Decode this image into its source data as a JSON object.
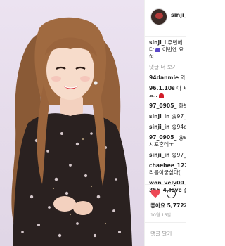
{
  "post": {
    "username": "sinji_i",
    "likes": "좋아요 5,772개",
    "date": "10월 16일",
    "add_comment": "댓글 달기..."
  },
  "caption": {
    "username": "sinji_i",
    "line1": " 주변에",
    "line2a": "다 ",
    "line2b": " 이번엔 요",
    "line3": "혀"
  },
  "more_comments": "댓글 더 보기",
  "comments": [
    {
      "user": "94danmie",
      "text": " 와..."
    },
    {
      "user": "96.1.10s",
      "text": " 아 세상"
    },
    {
      "user": "",
      "text": "요.."
    },
    {
      "user": "97_0905_",
      "text": " 화보"
    },
    {
      "user": "sinji_in",
      "text": " @97_0"
    },
    {
      "user": "sinji_in",
      "text": " @94da"
    },
    {
      "user": "97_0905_",
      "text": " @sir"
    },
    {
      "user": "",
      "text": "시포혼데ㅜ"
    },
    {
      "user": "sinji_in",
      "text": " @97_0"
    },
    {
      "user": "chaehee_1228",
      "text": ""
    },
    {
      "user": "",
      "text": "리를이궁싶다("
    },
    {
      "user": "won_vely00",
      "text": " 진"
    },
    {
      "user": "365_4_love",
      "text": " 집"
    }
  ],
  "colors": {
    "like_red": "#ed4956",
    "muted_gray": "#999999",
    "divider": "#efefef",
    "text": "#262626",
    "background": "#e5dbea"
  },
  "icons": [
    "heart-icon",
    "comment-icon",
    "purple-heart-icon",
    "red-heart-icon"
  ]
}
